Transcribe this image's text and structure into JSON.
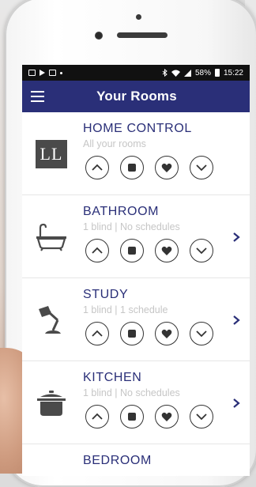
{
  "status_bar": {
    "battery": "58%",
    "time": "15:22"
  },
  "app_bar": {
    "title": "Your Rooms"
  },
  "rooms": [
    {
      "name": "HOME CONTROL",
      "subtitle": "All your rooms",
      "icon": "ll-logo",
      "has_chevron": false
    },
    {
      "name": "BATHROOM",
      "subtitle": "1 blind | No schedules",
      "icon": "bathtub-icon",
      "has_chevron": true
    },
    {
      "name": "STUDY",
      "subtitle": "1 blind | 1 schedule",
      "icon": "desk-lamp-icon",
      "has_chevron": true
    },
    {
      "name": "KITCHEN",
      "subtitle": "1 blind | No schedules",
      "icon": "cooking-pot-icon",
      "has_chevron": true
    },
    {
      "name": "BEDROOM"
    }
  ],
  "logo_text": "LL",
  "colors": {
    "app_bar": "#2a2f78",
    "room_name": "#2a2f78",
    "subtitle": "#c6c6c6"
  }
}
